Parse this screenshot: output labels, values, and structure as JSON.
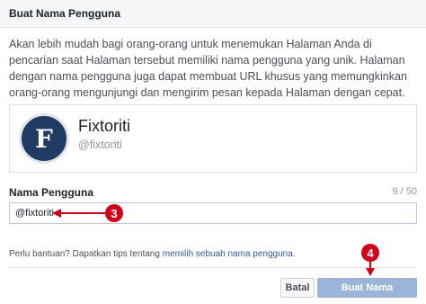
{
  "dialog": {
    "title": "Buat Nama Pengguna"
  },
  "intro": {
    "lines": [
      "Akan lebih mudah bagi orang-orang untuk menemukan Halaman Anda di",
      "pencarian saat Halaman tersebut memiliki nama pengguna yang unik. Halaman",
      "dengan nama pengguna juga dapat membuat URL khusus yang memungkinkan",
      "orang-orang mengunjungi dan mengirim pesan kepada Halaman dengan cepat."
    ]
  },
  "preview": {
    "avatar_letter": "F",
    "page_name": "Fixtoriti",
    "handle": "@fixtoriti"
  },
  "username_field": {
    "label": "Nama Pengguna",
    "char_count": "9 / 50",
    "value": "@fixtoriti"
  },
  "help": {
    "prefix": "Perlu bantuan? Dapatkan tips tentang ",
    "link_text": "memilih sebuah nama pengguna",
    "suffix": "."
  },
  "buttons": {
    "cancel_label": "Batal",
    "create_label": "Buat Nama Pengguna"
  },
  "annotations": {
    "step_3": "3",
    "step_4": "4",
    "color": "#d0021b"
  }
}
